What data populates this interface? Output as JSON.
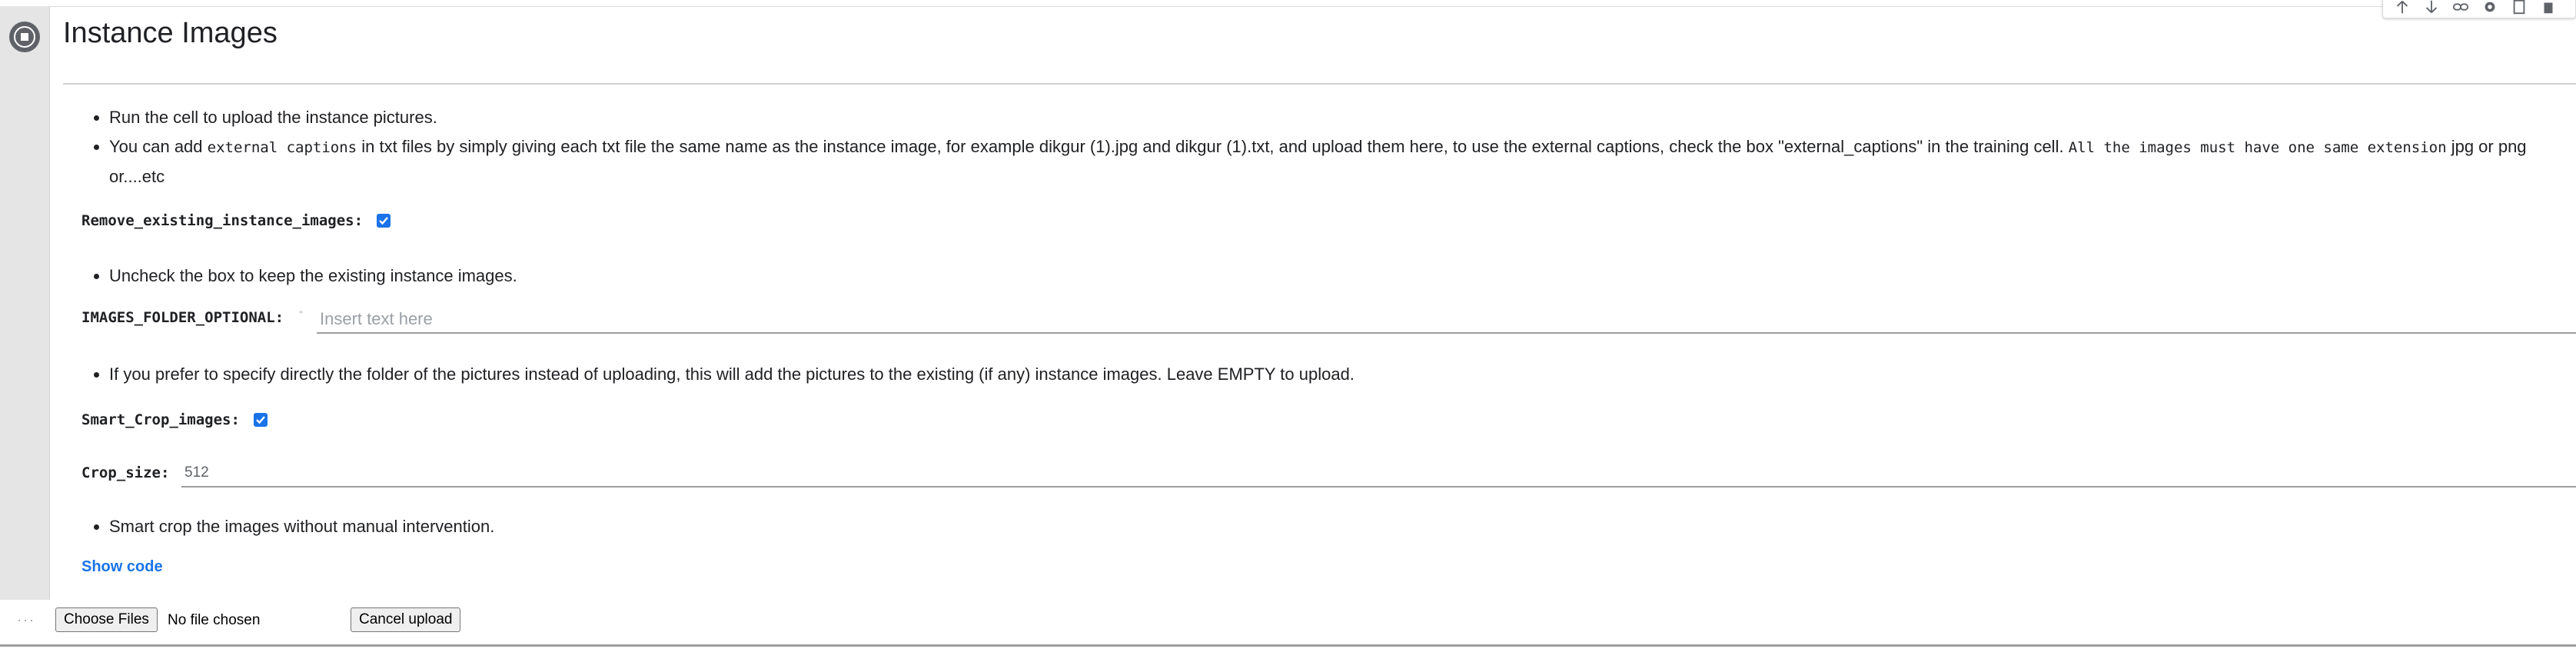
{
  "cell": {
    "title": "Instance Images",
    "toolbar_icons": [
      "arrow-up-icon",
      "arrow-down-icon",
      "link-icon",
      "gear-icon",
      "mirror-cell-icon",
      "delete-icon"
    ]
  },
  "bullets_intro": [
    "Run the cell to upload the instance pictures."
  ],
  "captions_note": {
    "part1": "You can add ",
    "code1": "external captions",
    "part2": " in txt files by simply giving each txt file the same name as the instance image, for example dikgur (1).jpg and dikgur (1).txt, and upload them here, to use the external captions, check the box \"external_captions\" in the training cell. ",
    "code2": "All the images must have one same extension",
    "part3": " jpg or png or....etc"
  },
  "form": {
    "remove_existing": {
      "label": "Remove_existing_instance_images:",
      "checked": true
    },
    "remove_note": "Uncheck the box to keep the existing instance images.",
    "images_folder": {
      "label": "IMAGES_FOLDER_OPTIONAL:",
      "quote_mark": "\"",
      "placeholder": "Insert text here",
      "value": ""
    },
    "images_folder_note": "If you prefer to specify directly the folder of the pictures instead of uploading, this will add the pictures to the existing (if any) instance images. Leave EMPTY to upload.",
    "smart_crop": {
      "label": "Smart_Crop_images:",
      "checked": true
    },
    "crop_size": {
      "label": "Crop_size:",
      "value": "512"
    },
    "crop_note": "Smart crop the images without manual intervention."
  },
  "show_code": "Show code",
  "output": {
    "dots": "···",
    "choose_files": "Choose Files",
    "no_file": "No file chosen",
    "cancel_upload": "Cancel upload"
  },
  "colors": {
    "accent": "#1a73e8",
    "gutter": "#e5e5e5",
    "rule": "#d0d0d0"
  }
}
